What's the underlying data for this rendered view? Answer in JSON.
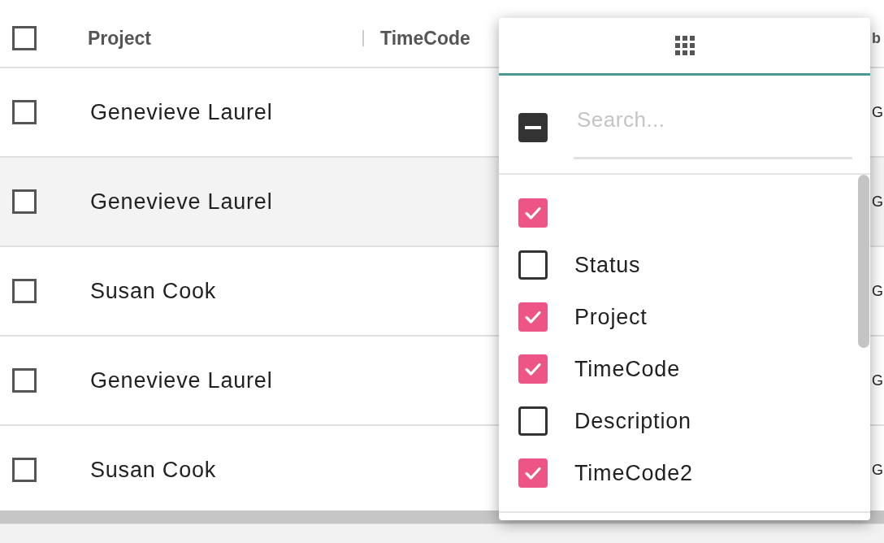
{
  "table": {
    "header_checkbox": {
      "checked": false
    },
    "columns": [
      "Project",
      "TimeCode",
      "b"
    ],
    "rows": [
      {
        "checked": false,
        "hovered": false,
        "project": "Genevieve Laurel",
        "column_3": "G"
      },
      {
        "checked": false,
        "hovered": true,
        "project": "Genevieve Laurel",
        "column_3": "G"
      },
      {
        "checked": false,
        "hovered": false,
        "project": "Susan Cook",
        "column_3": "G"
      },
      {
        "checked": false,
        "hovered": false,
        "project": "Genevieve Laurel",
        "column_3": "G"
      },
      {
        "checked": false,
        "hovered": false,
        "project": "Susan Cook",
        "column_3": "G"
      }
    ]
  },
  "column_menu": {
    "tabs": [
      {
        "selected": true
      }
    ],
    "select_all": {
      "indeterminate": true
    },
    "search": {
      "placeholder": "Search..."
    },
    "columns": [
      {
        "checked": true
      },
      {
        "label": "Status",
        "checked": false
      },
      {
        "label": "Project",
        "checked": true
      },
      {
        "label": "TimeCode",
        "checked": true
      },
      {
        "label": "Description",
        "checked": false
      },
      {
        "label": "TimeCode2",
        "checked": true
      }
    ]
  }
}
